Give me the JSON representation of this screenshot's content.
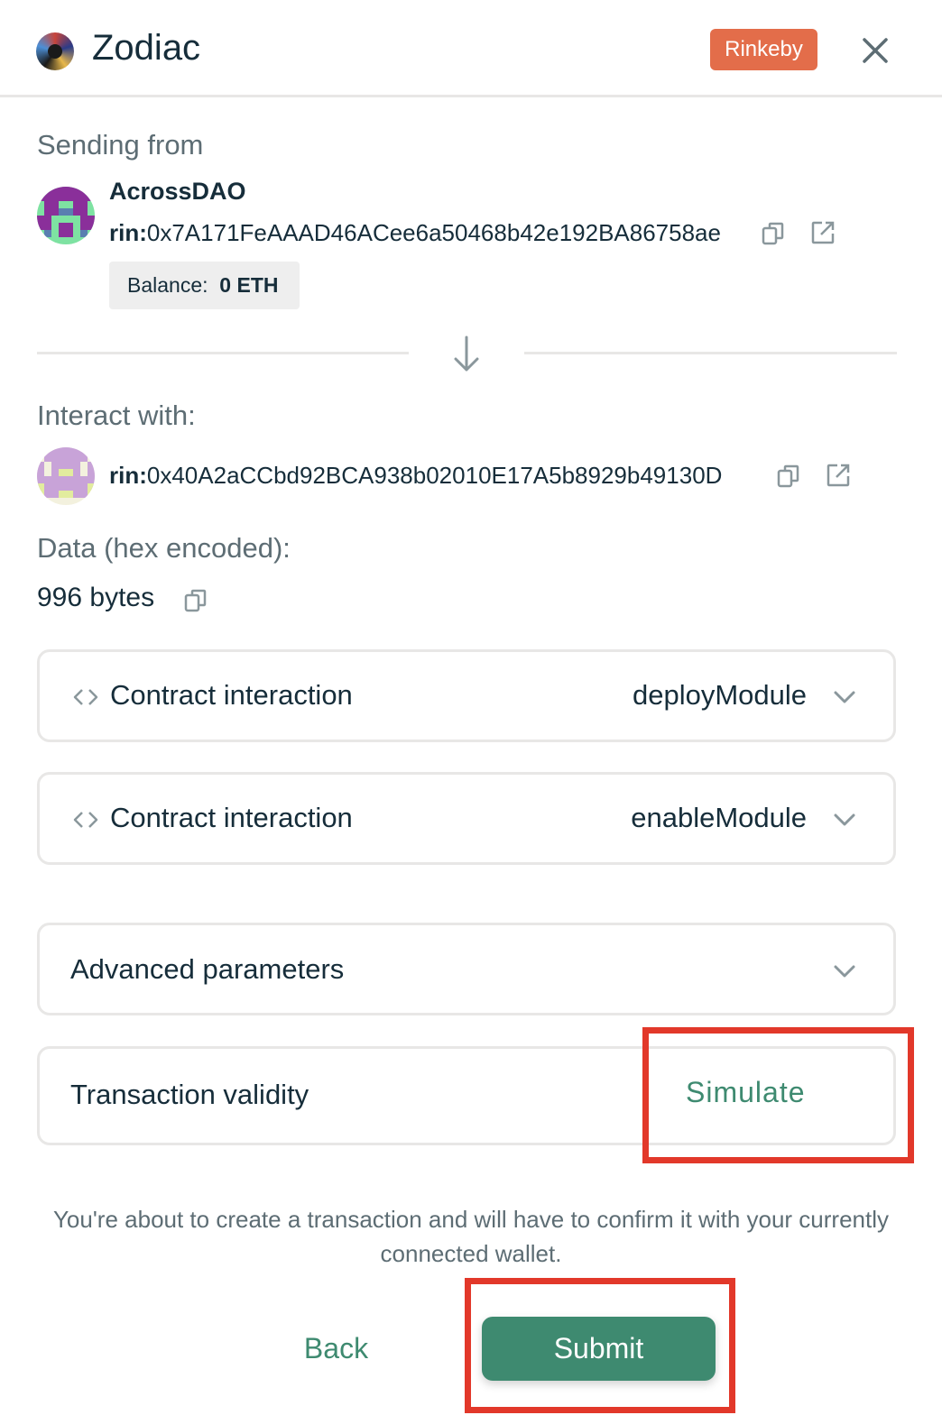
{
  "header": {
    "app_title": "Zodiac",
    "network_badge": "Rinkeby",
    "close_icon": "close-icon"
  },
  "sending_from": {
    "label": "Sending from",
    "account_name": "AcrossDAO",
    "address_prefix": "rin:",
    "address": "0x7A171FeAAAD46ACee6a50468b42e192BA86758ae",
    "balance_label": "Balance:",
    "balance_value": "0 ETH"
  },
  "interact_with": {
    "label": "Interact with:",
    "address_prefix": "rin:",
    "address": "0x40A2aCCbd92BCA938b02010E17A5b8929b49130D"
  },
  "data": {
    "label": "Data (hex encoded):",
    "size": "996 bytes"
  },
  "interactions": [
    {
      "title": "Contract interaction",
      "method": "deployModule"
    },
    {
      "title": "Contract interaction",
      "method": "enableModule"
    }
  ],
  "advanced": {
    "title": "Advanced parameters"
  },
  "validity": {
    "title": "Transaction validity",
    "action": "Simulate"
  },
  "note": "You're about to create a transaction and will have to confirm it with your currently connected wallet.",
  "footer": {
    "back_label": "Back",
    "submit_label": "Submit"
  },
  "colors": {
    "accent": "#3e8a70",
    "badge": "#e36d4a",
    "highlight": "#e2382a"
  }
}
